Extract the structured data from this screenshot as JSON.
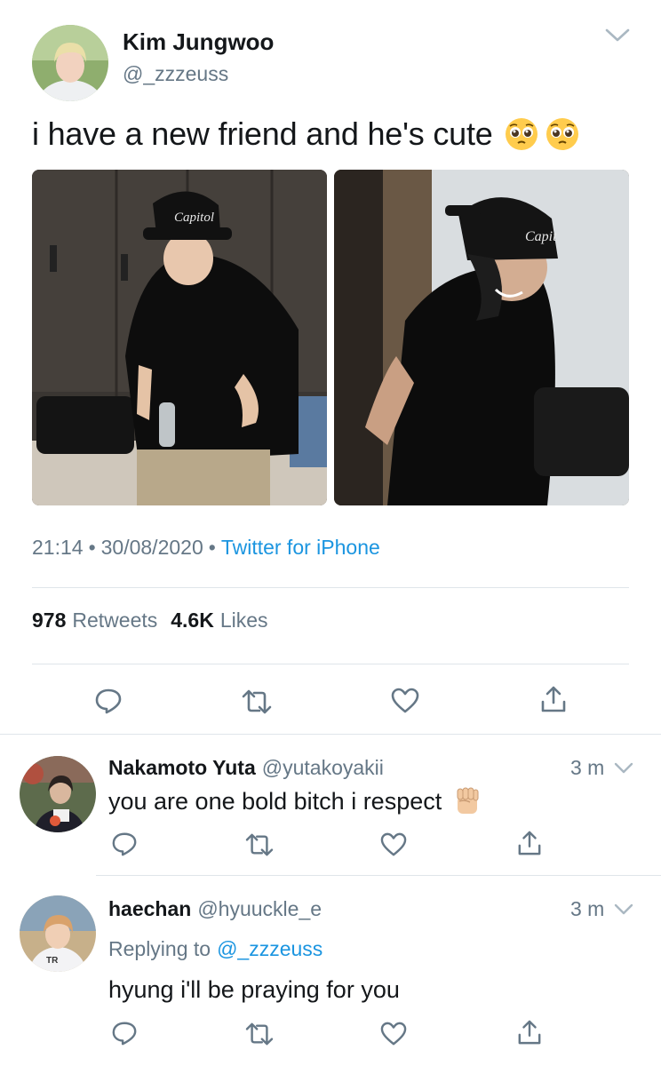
{
  "main_tweet": {
    "author_name": "Kim Jungwoo",
    "author_handle": "@_zzzeuss",
    "text": "i have a new friend and he's cute",
    "emojis": [
      "pleading-face-emoji",
      "pleading-face-emoji"
    ],
    "time": "21:14",
    "sep1": "•",
    "date": "30/08/2020",
    "sep2": "•",
    "source": "Twitter for iPhone",
    "retweets_count": "978",
    "retweets_label": "Retweets",
    "likes_count": "4.6K",
    "likes_label": "Likes",
    "photos": [
      {
        "description": "man in black cap and black t-shirt holding water bottle"
      },
      {
        "description": "man in black cap smiling, looking down"
      }
    ]
  },
  "replies": [
    {
      "author_name": "Nakamoto Yuta",
      "author_handle": "@yutakoyakii",
      "time": "3 m",
      "text": "you are one bold bitch i respect",
      "emoji": "raised-fist-emoji"
    },
    {
      "author_name": "haechan",
      "author_handle": "@hyuuckle_e",
      "time": "3 m",
      "replying_prefix": "Replying to",
      "replying_handle": "@_zzzeuss",
      "text": "hyung i'll be praying for you"
    }
  ],
  "colors": {
    "link": "#1b95e0",
    "grey_text": "#657786",
    "divider": "#dfe5ea",
    "icon": "#657786"
  }
}
